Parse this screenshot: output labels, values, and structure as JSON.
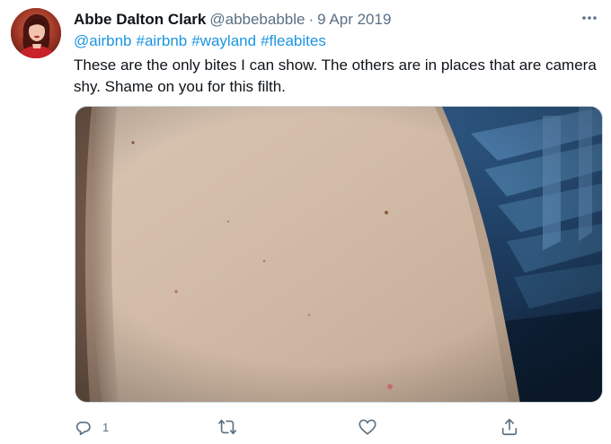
{
  "tweet": {
    "display_name": "Abbe Dalton Clark",
    "handle": "@abbebabble",
    "separator": "·",
    "date": "9 Apr 2019",
    "mentions": [
      "@airbnb",
      "#airbnb",
      "#wayland",
      "#fleabites"
    ],
    "text": "These are the only bites I can show. The others are in places that are camera shy. Shame on you for this filth.",
    "media_icon": "photo-of-arm-with-bites"
  },
  "actions": {
    "reply_icon": "reply-icon",
    "reply_count": "1",
    "retweet_icon": "retweet-icon",
    "like_icon": "heart-icon",
    "share_icon": "share-icon"
  },
  "colors": {
    "link": "#1b95e0",
    "secondary_text": "#5b7083",
    "primary_text": "#0f1419",
    "border": "#cfd9de"
  }
}
